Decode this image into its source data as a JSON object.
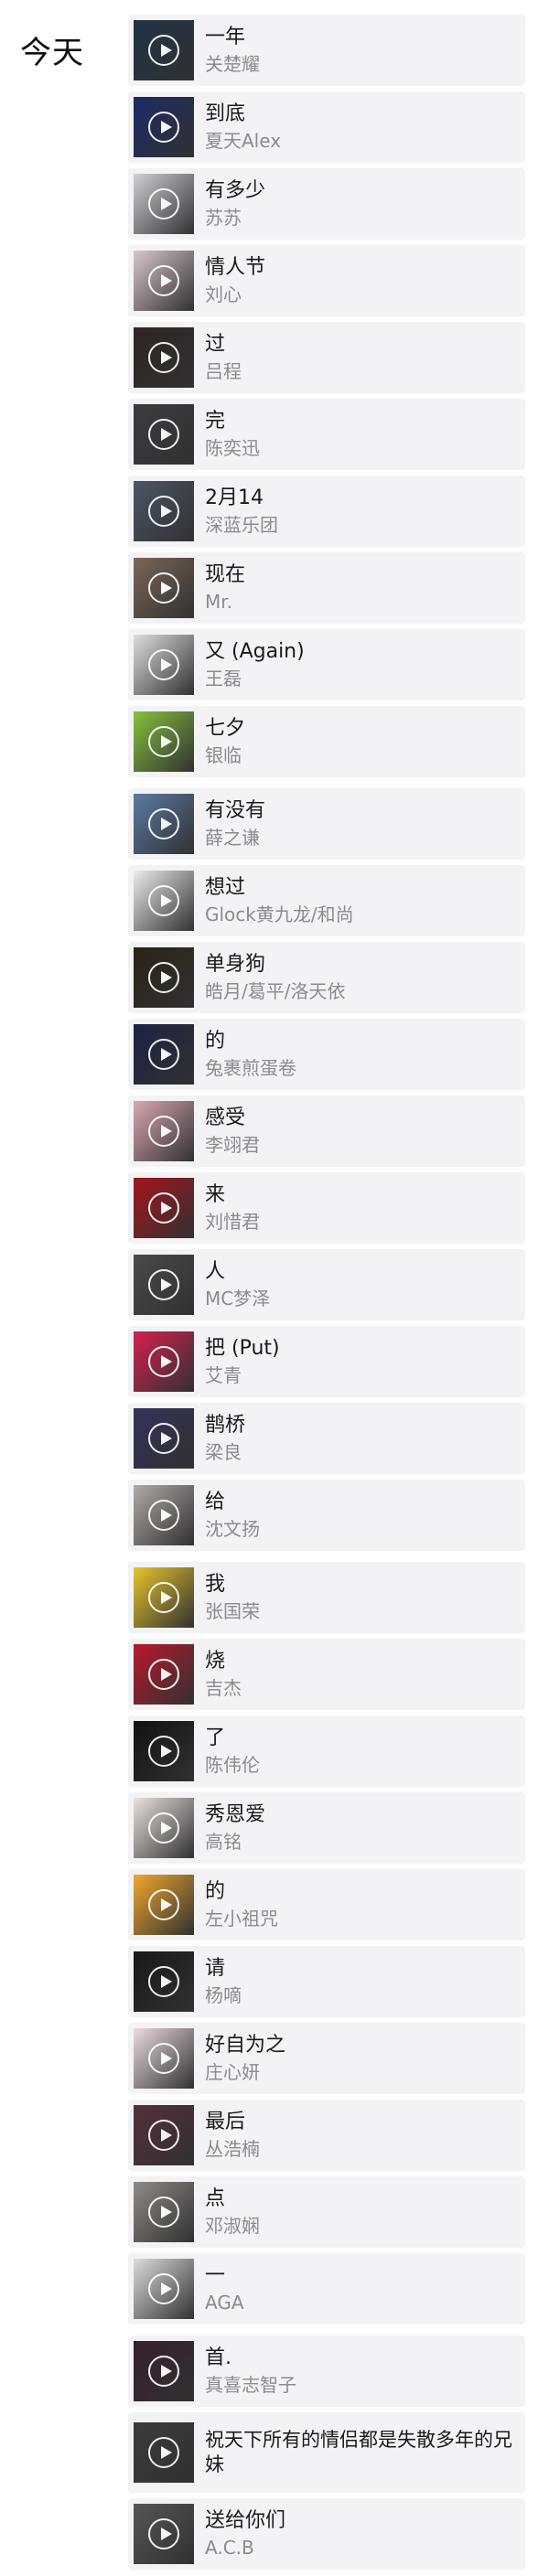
{
  "section_title": "今天",
  "songs": [
    {
      "title": "一年",
      "artist": "关楚耀",
      "thumb": "#1f3347"
    },
    {
      "title": "到底",
      "artist": "夏天Alex",
      "thumb": "#1c2a66"
    },
    {
      "title": "有多少",
      "artist": "苏苏",
      "thumb": "#cfcfd4"
    },
    {
      "title": "情人节",
      "artist": "刘心",
      "thumb": "#d9c6cc"
    },
    {
      "title": "过",
      "artist": "吕程",
      "thumb": "#2d2522"
    },
    {
      "title": "完",
      "artist": "陈奕迅",
      "thumb": "#3c3c3f"
    },
    {
      "title": "2月14",
      "artist": "深蓝乐团",
      "thumb": "#4b5666"
    },
    {
      "title": "现在",
      "artist": "Mr.",
      "thumb": "#7b6757"
    },
    {
      "title": "又 (Again)",
      "artist": "王磊",
      "thumb": "#dedede"
    },
    {
      "title": "七夕",
      "artist": "银临",
      "thumb": "#86c13c"
    },
    {
      "title": "有没有",
      "artist": "薛之谦",
      "thumb": "#5b7aa1"
    },
    {
      "title": "想过",
      "artist": "Glock黄九龙/和尚",
      "thumb": "#ececec"
    },
    {
      "title": "单身狗",
      "artist": "皓月/葛平/洛天依",
      "thumb": "#2a2417"
    },
    {
      "title": "的",
      "artist": "兔裹煎蛋卷",
      "thumb": "#1d2244"
    },
    {
      "title": "感受",
      "artist": "李翊君",
      "thumb": "#d9a9b1"
    },
    {
      "title": "来",
      "artist": "刘惜君",
      "thumb": "#a4141d"
    },
    {
      "title": "人",
      "artist": "MC梦泽",
      "thumb": "#4a4a4a"
    },
    {
      "title": "把 (Put)",
      "artist": "艾青",
      "thumb": "#d4204f"
    },
    {
      "title": "鹊桥",
      "artist": "梁良",
      "thumb": "#34325a"
    },
    {
      "title": "给",
      "artist": "沈文扬",
      "thumb": "#b1aaa6"
    },
    {
      "title": "我",
      "artist": "张国荣",
      "thumb": "#e6c42c"
    },
    {
      "title": "烧",
      "artist": "吉杰",
      "thumb": "#b8192d"
    },
    {
      "title": "了",
      "artist": "陈伟伦",
      "thumb": "#121212"
    },
    {
      "title": "秀恩爱",
      "artist": "高铭",
      "thumb": "#e8e2df"
    },
    {
      "title": "的",
      "artist": "左小祖咒",
      "thumb": "#f0a72e"
    },
    {
      "title": "请",
      "artist": "杨嘀",
      "thumb": "#181818"
    },
    {
      "title": "好自为之",
      "artist": "庄心妍",
      "thumb": "#eadbe0"
    },
    {
      "title": "最后",
      "artist": "丛浩楠",
      "thumb": "#54303a"
    },
    {
      "title": "点",
      "artist": "邓淑娴",
      "thumb": "#8d8b87"
    },
    {
      "title": "一",
      "artist": "AGA",
      "thumb": "#dcdcdc"
    },
    {
      "title": "首.",
      "artist": "真喜志智子",
      "thumb": "#381f2b"
    },
    {
      "title": "祝天下所有的情侣都是失散多年的兄妹",
      "artist": "",
      "thumb": "#3b3b3b"
    },
    {
      "title": "送给你们",
      "artist": "A.C.B",
      "thumb": "#565656"
    }
  ]
}
